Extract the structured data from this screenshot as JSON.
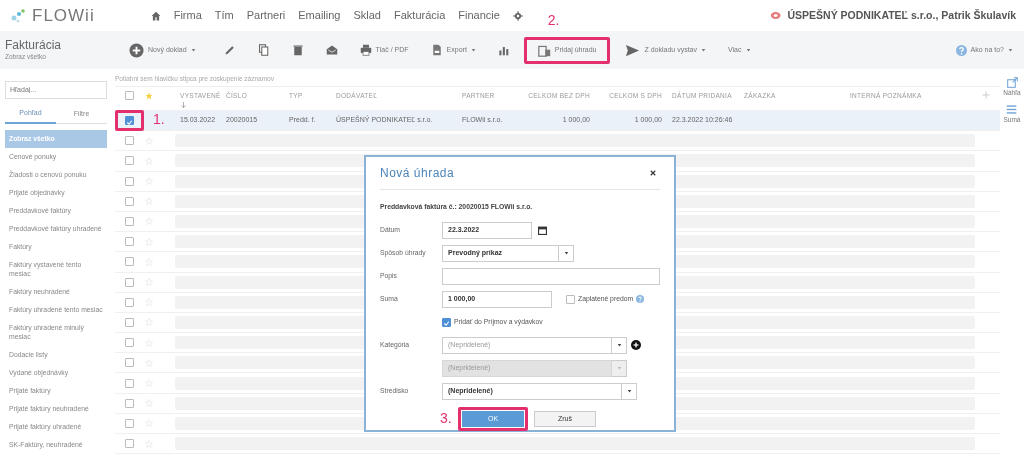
{
  "logo": {
    "text": "FLOWii"
  },
  "nav": [
    {
      "label": "Firma"
    },
    {
      "label": "Tím"
    },
    {
      "label": "Partneri"
    },
    {
      "label": "Emailing"
    },
    {
      "label": "Sklad"
    },
    {
      "label": "Fakturácia"
    },
    {
      "label": "Financie"
    }
  ],
  "account": {
    "label": "ÚSPEŠNÝ PODNIKATEĽ s.r.o., Patrik Škulavík"
  },
  "page": {
    "title": "Fakturácia",
    "subtitle": "Zobraz všetko"
  },
  "toolbar": [
    {
      "label": "Nový doklad",
      "dropdown": true,
      "highlighted": false
    },
    {
      "dropdown": false,
      "highlighted": false
    },
    {
      "dropdown": false,
      "highlighted": false
    },
    {
      "dropdown": false,
      "highlighted": false
    },
    {
      "dropdown": false,
      "highlighted": false
    },
    {
      "label": "Tlač / PDF",
      "dropdown": false,
      "highlighted": false
    },
    {
      "label": "Export",
      "dropdown": true,
      "highlighted": false
    },
    {
      "dropdown": false,
      "highlighted": false
    },
    {
      "label": "Pridaj úhradu",
      "dropdown": false,
      "highlighted": true,
      "annotation": "2."
    },
    {
      "label": "Z dokladu vystav",
      "dropdown": true,
      "highlighted": false
    },
    {
      "label": "Viac",
      "dropdown": true,
      "highlighted": false
    }
  ],
  "help": {
    "label": "Ako na to?"
  },
  "sidebar": {
    "search_placeholder": "Hľadaj...",
    "tabs": [
      {
        "label": "Pohľad",
        "selected": true
      },
      {
        "label": "Filtre",
        "selected": false
      }
    ],
    "items": [
      {
        "label": "Zobraz všetko",
        "selected": true
      },
      {
        "label": "Cenové ponuky",
        "selected": false
      },
      {
        "label": "Žiadosti o cenovú ponuku",
        "selected": false
      },
      {
        "label": "Prijaté objednávky",
        "selected": false
      },
      {
        "label": "Preddavkové faktúry",
        "selected": false
      },
      {
        "label": "Preddavkové faktúry uhradené",
        "selected": false
      },
      {
        "label": "Faktúry",
        "selected": false
      },
      {
        "label": "Faktúry vystavené tento mesiac",
        "selected": false
      },
      {
        "label": "Faktúry neuhradené",
        "selected": false
      },
      {
        "label": "Faktúry uhradené tento mesiac",
        "selected": false
      },
      {
        "label": "Faktúry uhradené minulý mesiac",
        "selected": false
      },
      {
        "label": "Dodacie listy",
        "selected": false
      },
      {
        "label": "Vydané objednávky",
        "selected": false
      },
      {
        "label": "Prijaté faktúry",
        "selected": false
      },
      {
        "label": "Prijaté faktúry neuhradené",
        "selected": false
      },
      {
        "label": "Prijaté faktúry uhradené",
        "selected": false
      },
      {
        "label": "SK-Faktúry, neuhradené",
        "selected": false
      }
    ]
  },
  "table": {
    "header_checked": false,
    "group_hint": "Potiahni sem hlavičku stĺpca pre zoskupenie záznamov",
    "columns": [
      "VYSTAVENÉ",
      "ČÍSLO",
      "TYP",
      "DODÁVATEĽ",
      "PARTNER",
      "CELKOM BEZ DPH",
      "CELKOM S DPH",
      "DÁTUM PRIDANIA",
      "ZÁKAZKA",
      "INTERNÁ POZNÁMKA"
    ],
    "rows": [
      {
        "checked": true,
        "selected": true,
        "annotation": "1.",
        "cells": [
          "15.03.2022",
          "20020015",
          "Predd. f.",
          "ÚSPEŠNÝ PODNIKATEĽ s.r.o.",
          "FLOWii s.r.o.",
          "1 000,00",
          "1 000,00",
          "22.3.2022 10:26:46"
        ]
      },
      {
        "checked": false,
        "selected": false
      },
      {
        "checked": false,
        "selected": false
      },
      {
        "checked": false,
        "selected": false
      },
      {
        "checked": false,
        "selected": false
      },
      {
        "checked": false,
        "selected": false
      },
      {
        "checked": false,
        "selected": false
      },
      {
        "checked": false,
        "selected": false
      },
      {
        "checked": false,
        "selected": false
      },
      {
        "checked": false,
        "selected": false
      },
      {
        "checked": false,
        "selected": false
      },
      {
        "checked": false,
        "selected": false
      },
      {
        "checked": false,
        "selected": false
      },
      {
        "checked": false,
        "selected": false
      },
      {
        "checked": false,
        "selected": false
      },
      {
        "checked": false,
        "selected": false
      },
      {
        "checked": false,
        "selected": false
      }
    ]
  },
  "right_panel": [
    {
      "label": "Náhľa"
    },
    {
      "label": "Sumá"
    }
  ],
  "dialog": {
    "title": "Nová úhrada",
    "heading": "Preddavková faktúra č.: 20020015 FLOWii s.r.o.",
    "fields": [
      {
        "kind": "date",
        "label": "Dátum",
        "value": "22.3.2022",
        "disabled": false
      },
      {
        "kind": "select",
        "label": "Spôsob úhrady",
        "value": "Prevodný príkaz",
        "disabled": false
      },
      {
        "kind": "text",
        "label": "Popis",
        "disabled": false
      },
      {
        "kind": "amount",
        "label": "Suma",
        "value": "1 000,00",
        "disabled": false,
        "checkbox": {
          "label": "Zaplatené predom",
          "checked": false
        }
      },
      {
        "kind": "checkbox",
        "label": "Pridať do Príjmov a výdavkov",
        "checked": true,
        "disabled": false
      },
      {
        "kind": "select-add",
        "label": "Kategória",
        "placeholder": "(Nepridelené)",
        "disabled": false
      },
      {
        "kind": "select",
        "placeholder": "(Nepridelené)",
        "disabled": true
      },
      {
        "kind": "select-wide",
        "label": "Stredisko",
        "value": "(Nepridelené)",
        "disabled": false
      }
    ],
    "buttons": [
      {
        "label": "OK",
        "primary": true,
        "highlighted": true,
        "annotation": "3."
      },
      {
        "label": "Zruš",
        "primary": false,
        "highlighted": false
      }
    ]
  }
}
